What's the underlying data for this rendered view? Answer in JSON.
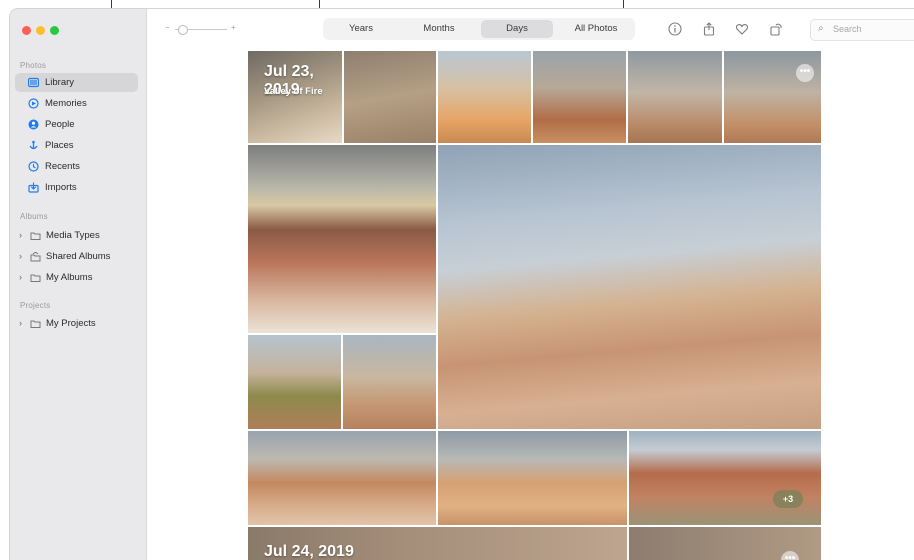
{
  "window": {
    "traffic_lights": {
      "close": "#fe5f57",
      "minimize": "#febc2e",
      "zoom": "#28c840"
    }
  },
  "sidebar": {
    "sections": {
      "photos": "Photos",
      "albums": "Albums",
      "projects": "Projects"
    },
    "photos_items": [
      {
        "label": "Library",
        "icon": "library-icon",
        "selected": true
      },
      {
        "label": "Memories",
        "icon": "memories-icon"
      },
      {
        "label": "People",
        "icon": "people-icon"
      },
      {
        "label": "Places",
        "icon": "places-icon"
      },
      {
        "label": "Recents",
        "icon": "recents-icon"
      },
      {
        "label": "Imports",
        "icon": "imports-icon"
      }
    ],
    "album_items": [
      {
        "label": "Media Types",
        "icon": "folder-icon"
      },
      {
        "label": "Shared Albums",
        "icon": "shared-albums-icon"
      },
      {
        "label": "My Albums",
        "icon": "folder-icon"
      }
    ],
    "project_items": [
      {
        "label": "My Projects",
        "icon": "folder-icon"
      }
    ],
    "accent_color": "#1c7cf4"
  },
  "toolbar": {
    "zoom_minus": "−",
    "zoom_plus": "+",
    "views": [
      "Years",
      "Months",
      "Days",
      "All Photos"
    ],
    "active_view": "Days",
    "icons": [
      "info-icon",
      "share-icon",
      "favorite-heart-icon",
      "rotate-icon"
    ],
    "search_placeholder": "Search"
  },
  "grid": {
    "day1": {
      "date": "Jul 23, 2019",
      "location": "Valley of Fire"
    },
    "day2": {
      "date": "Jul 24, 2019"
    },
    "more_badge": "•••",
    "extra_count": "+3"
  }
}
